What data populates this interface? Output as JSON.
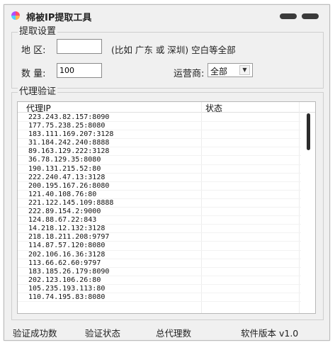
{
  "window": {
    "title": "棉被IP提取工具"
  },
  "extract_settings": {
    "group_label": "提取设置",
    "region_label": "地  区:",
    "region_value": "",
    "region_hint": "(比如  广东  或  深圳)  空白等全部",
    "quantity_label": "数  量:",
    "quantity_value": "100",
    "operator_label": "运营商:",
    "operator_value": "全部"
  },
  "proxy_verify": {
    "group_label": "代理验证",
    "columns": [
      "代理IP",
      "状态"
    ],
    "rows": [
      "223.243.82.157:8090",
      "177.75.238.25:8080",
      "183.111.169.207:3128",
      "31.184.242.240:8888",
      "89.163.129.222:3128",
      "36.78.129.35:8080",
      "190.131.215.52:80",
      "222.240.47.13:3128",
      "200.195.167.26:8080",
      "121.40.108.76:80",
      "221.122.145.109:8888",
      "222.89.154.2:9000",
      "124.88.67.22:843",
      "14.218.12.132:3128",
      "218.18.211.208:9797",
      "114.87.57.120:8080",
      "202.106.16.36:3128",
      "113.66.62.60:9797",
      "183.185.26.179:8090",
      "202.123.106.26:80",
      "105.235.193.113:80",
      "110.74.195.83:8080"
    ]
  },
  "status_bar": {
    "success_count": "验证成功数",
    "verify_status": "验证状态",
    "total_proxies": "总代理数",
    "version": "软件版本 v1.0"
  }
}
